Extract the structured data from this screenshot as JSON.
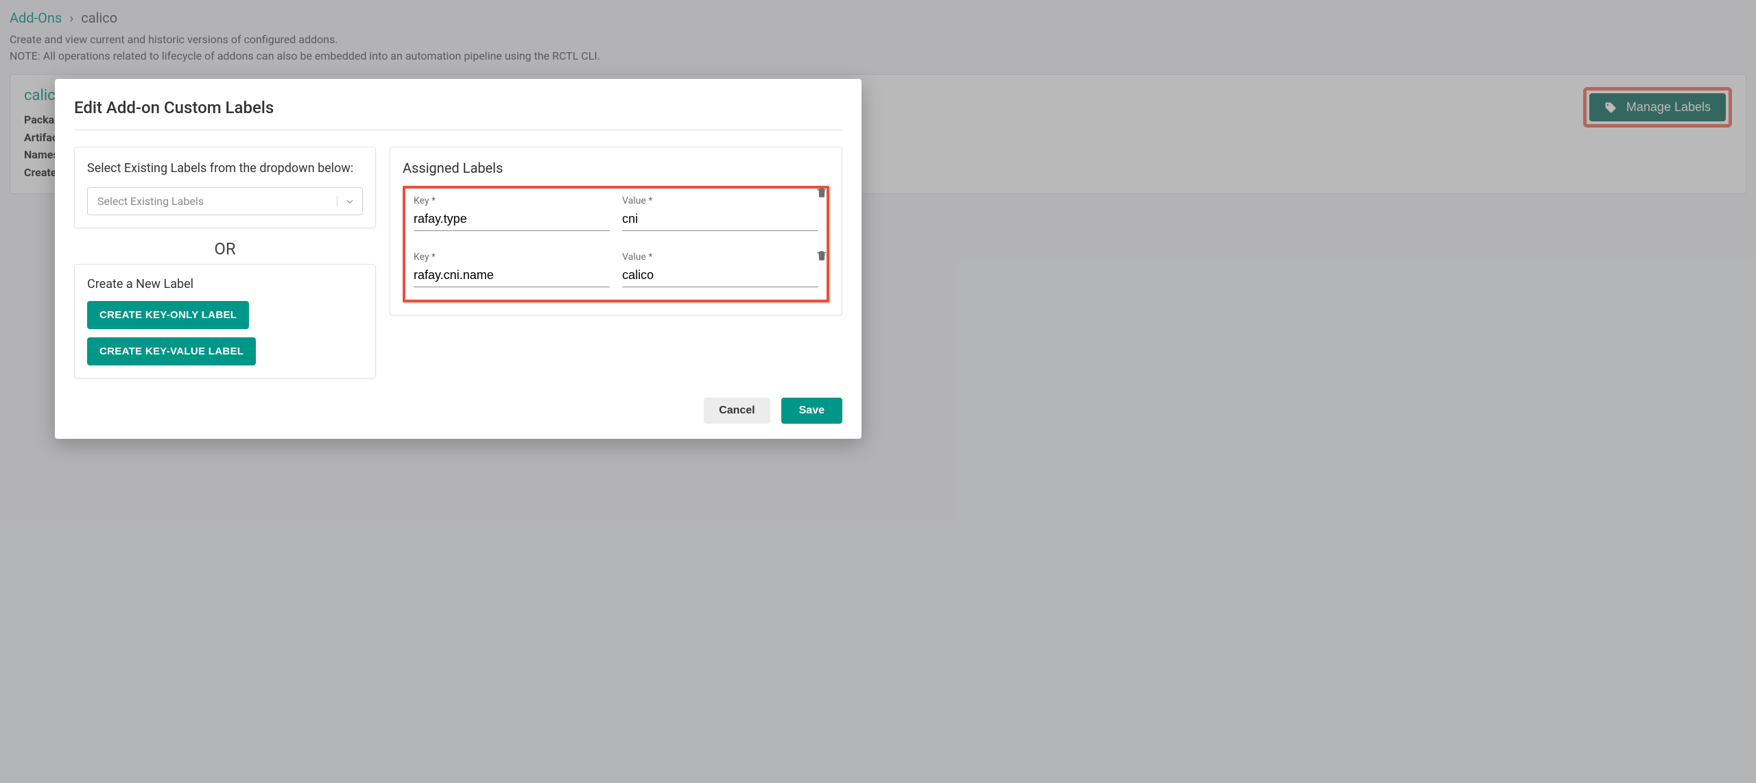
{
  "breadcrumb": {
    "root": "Add-Ons",
    "sep": "›",
    "current": "calico"
  },
  "subtext": {
    "line1": "Create and view current and historic versions of configured addons.",
    "line2": "NOTE: All operations related to lifecycle of addons can also be embedded into an automation pipeline using the RCTL CLI."
  },
  "card": {
    "title": "calico",
    "meta": [
      "Packa",
      "Artifac",
      "Names",
      "Create"
    ],
    "manage_labels": "Manage Labels"
  },
  "modal": {
    "title": "Edit Add-on Custom Labels",
    "left": {
      "select_label": "Select Existing Labels from the dropdown below:",
      "select_placeholder": "Select Existing Labels",
      "or": "OR",
      "create_title": "Create a New Label",
      "create_key_only": "CREATE KEY-ONLY LABEL",
      "create_key_value": "CREATE KEY-VALUE LABEL"
    },
    "right": {
      "title": "Assigned Labels",
      "key_label": "Key *",
      "value_label": "Value *",
      "rows": [
        {
          "key": "rafay.type",
          "value": "cni"
        },
        {
          "key": "rafay.cni.name",
          "value": "calico"
        }
      ]
    },
    "footer": {
      "cancel": "Cancel",
      "save": "Save"
    }
  }
}
